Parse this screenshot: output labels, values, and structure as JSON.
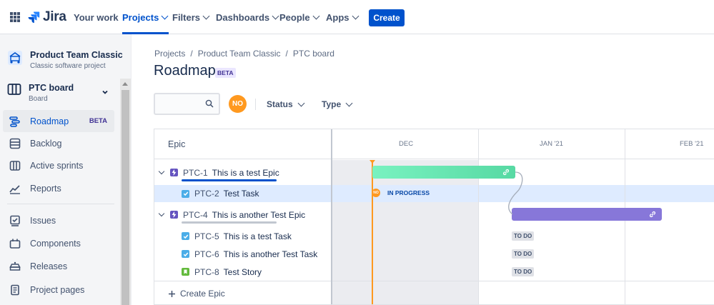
{
  "nav": {
    "logo": "Jira",
    "items": [
      {
        "label": "Your work"
      },
      {
        "label": "Projects"
      },
      {
        "label": "Filters"
      },
      {
        "label": "Dashboards"
      },
      {
        "label": "People"
      },
      {
        "label": "Apps"
      }
    ],
    "create_label": "Create",
    "active_item": "Projects"
  },
  "sidebar": {
    "project_name": "Product Team Classic",
    "project_type": "Classic software project",
    "board_name": "PTC board",
    "board_sub": "Board",
    "items": [
      {
        "label": "Roadmap",
        "badge": "BETA",
        "icon": "roadmap-icon",
        "active": true
      },
      {
        "label": "Backlog",
        "icon": "backlog-icon"
      },
      {
        "label": "Active sprints",
        "icon": "active-sprints-icon"
      },
      {
        "label": "Reports",
        "icon": "reports-icon"
      },
      {
        "label": "Issues",
        "icon": "issues-icon"
      },
      {
        "label": "Components",
        "icon": "components-icon"
      },
      {
        "label": "Releases",
        "icon": "releases-icon"
      },
      {
        "label": "Project pages",
        "icon": "project-pages-icon"
      }
    ]
  },
  "breadcrumb": [
    "Projects",
    "Product Team Classic",
    "PTC board"
  ],
  "breadcrumb_sep": "/",
  "page_title": "Roadmap",
  "page_badge": "BETA",
  "search": {
    "placeholder": ""
  },
  "avatar_initials": "NO",
  "filters": [
    {
      "label": "Status"
    },
    {
      "label": "Type"
    }
  ],
  "roadmap": {
    "column_header": "Epic",
    "months": [
      "DEC",
      "JAN '21",
      "FEB '21"
    ],
    "rows": [
      {
        "kind": "epic",
        "key": "PTC-1",
        "summary": "This is a test Epic",
        "progress_color": "#0052CC"
      },
      {
        "kind": "task",
        "key": "PTC-2",
        "summary": "Test Task",
        "status": "IN PROGRESS",
        "assignee": "NO"
      },
      {
        "kind": "epic",
        "key": "PTC-4",
        "summary": "This is another Test Epic",
        "progress_color": "#C1C7D0"
      },
      {
        "kind": "task",
        "key": "PTC-5",
        "summary": "This is a test Task",
        "status": "TO DO"
      },
      {
        "kind": "task",
        "key": "PTC-6",
        "summary": "This is another Test Task",
        "status": "TO DO"
      },
      {
        "kind": "story",
        "key": "PTC-8",
        "summary": "Test Story",
        "status": "TO DO"
      }
    ],
    "create_epic_label": "Create Epic"
  },
  "colors": {
    "brand": "#0052CC",
    "epic_bar_1": "#57D9A3",
    "epic_bar_2": "#8777D9",
    "today_marker": "#FF991F"
  }
}
